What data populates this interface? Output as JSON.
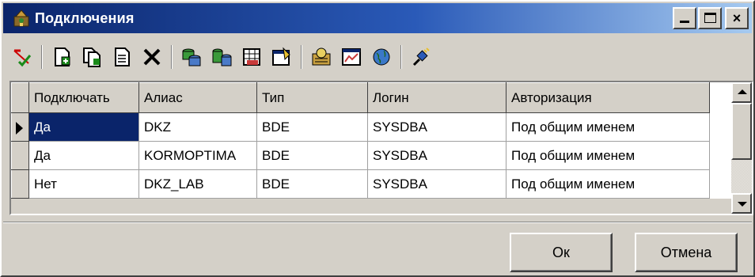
{
  "window": {
    "title": "Подключения",
    "icon": "connections-app-icon"
  },
  "title_buttons": {
    "minimize": "minimize-icon",
    "maximize": "maximize-icon",
    "close_label": "×"
  },
  "toolbar": {
    "items": [
      "refresh-check-icon",
      "new-connection-icon",
      "copy-connection-icon",
      "edit-document-icon",
      "delete-icon",
      "database-icon",
      "database-add-icon",
      "sql-table-icon",
      "properties-icon",
      "connect-settings-icon",
      "chart-window-icon",
      "globe-icon",
      "plug-icon"
    ]
  },
  "grid": {
    "columns": [
      "Подключать",
      "Алиас",
      "Тип",
      "Логин",
      "Авторизация"
    ],
    "rows": [
      [
        "Да",
        "DKZ",
        "BDE",
        "SYSDBA",
        "Под общим именем"
      ],
      [
        "Да",
        "KORMOPTIMA",
        "BDE",
        "SYSDBA",
        "Под общим именем"
      ],
      [
        "Нет",
        "DKZ_LAB",
        "BDE",
        "SYSDBA",
        "Под общим именем"
      ]
    ],
    "selected_row": 0
  },
  "buttons": {
    "ok": "Ок",
    "cancel": "Отмена"
  },
  "colors": {
    "title_gradient_start": "#0a246a",
    "title_gradient_end": "#a6caf0",
    "selection": "#0a246a",
    "face": "#d4d0c8"
  }
}
